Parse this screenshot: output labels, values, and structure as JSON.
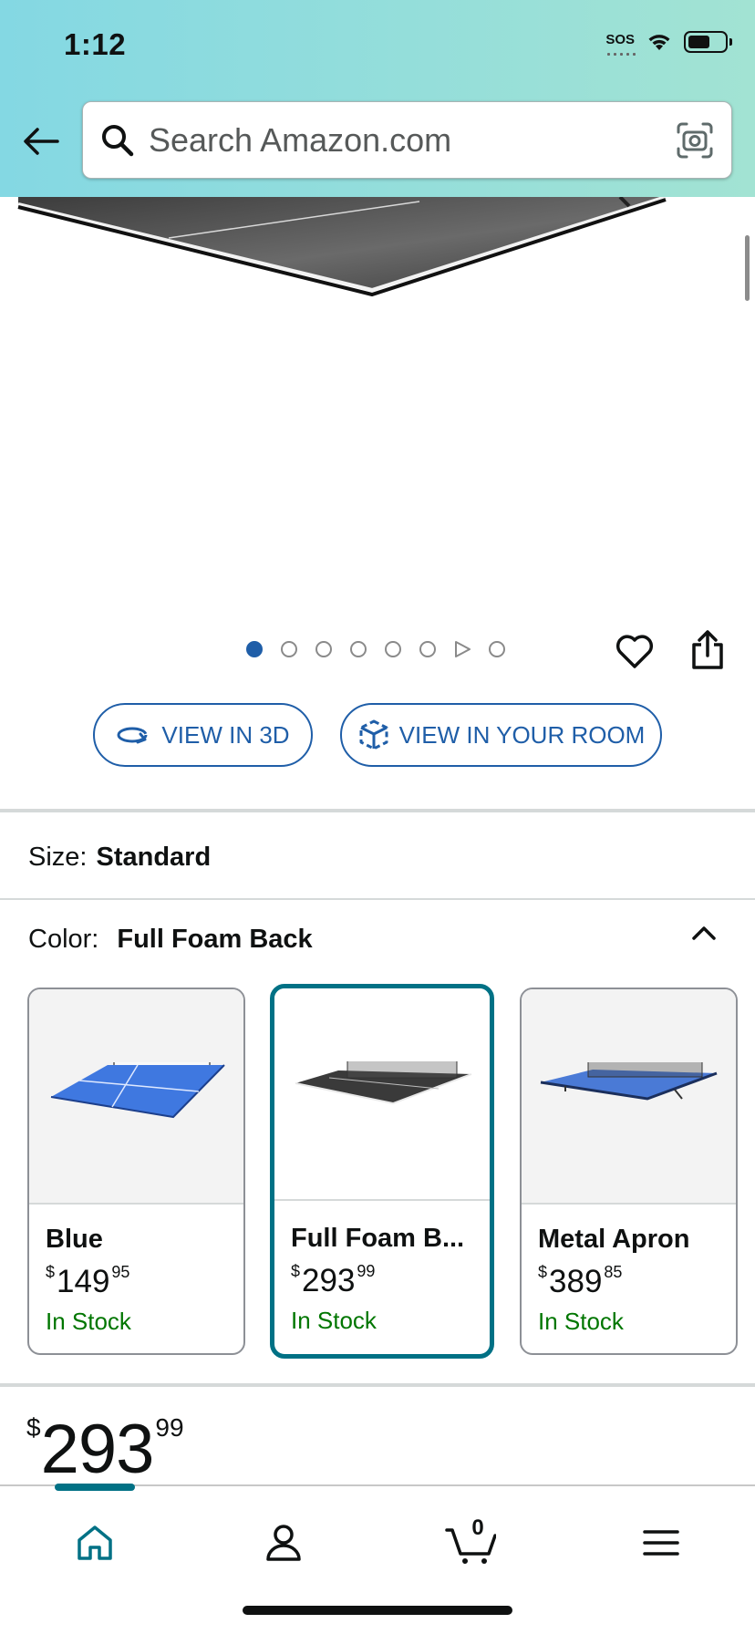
{
  "status_bar": {
    "time": "1:12",
    "sos": "SOS"
  },
  "search": {
    "placeholder": "Search Amazon.com"
  },
  "carousel": {
    "image_count": 7,
    "active_index": 0,
    "has_video": true
  },
  "ar_buttons": {
    "view_3d": "VIEW IN 3D",
    "view_room": "VIEW IN YOUR ROOM"
  },
  "size": {
    "label": "Size:",
    "value": "Standard"
  },
  "color": {
    "label": "Color:",
    "value": "Full Foam Back"
  },
  "variants": [
    {
      "name": "Blue",
      "currency": "$",
      "price_whole": "149",
      "price_fraction": "95",
      "stock": "In Stock",
      "table_color": "#3f78e0",
      "selected": false
    },
    {
      "name": "Full Foam B...",
      "currency": "$",
      "price_whole": "293",
      "price_fraction": "99",
      "stock": "In Stock",
      "table_color": "#3a3a3a",
      "selected": true
    },
    {
      "name": "Metal Apron",
      "currency": "$",
      "price_whole": "389",
      "price_fraction": "85",
      "stock": "In Stock",
      "table_color": "#4a7ad6",
      "selected": false
    }
  ],
  "price": {
    "currency": "$",
    "whole": "293",
    "fraction": "99"
  },
  "bottom_nav": {
    "cart_count": "0",
    "items": [
      "home-icon",
      "account-icon",
      "cart-icon",
      "menu-icon"
    ]
  },
  "colors": {
    "accent": "#007185",
    "link_blue": "#1f5ea8",
    "in_stock": "#007600",
    "header_start": "#84d8e3",
    "header_end": "#a2e3d3"
  }
}
